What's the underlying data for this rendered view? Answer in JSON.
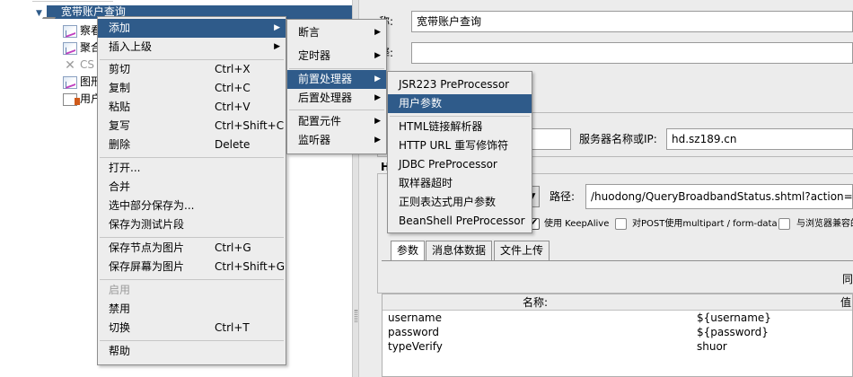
{
  "tree": {
    "items": [
      {
        "label": "宽带账户查询",
        "selected": true
      },
      {
        "label": "察看"
      },
      {
        "label": "聚合"
      },
      {
        "label": "CS"
      },
      {
        "label": "图形"
      },
      {
        "label": "用户"
      }
    ]
  },
  "context_menu": {
    "items": [
      {
        "label": "添加",
        "submenu": true,
        "highlighted": true
      },
      {
        "label": "插入上级",
        "submenu": true
      },
      {
        "label": "剪切",
        "shortcut": "Ctrl+X"
      },
      {
        "label": "复制",
        "shortcut": "Ctrl+C"
      },
      {
        "label": "粘贴",
        "shortcut": "Ctrl+V"
      },
      {
        "label": "复写",
        "shortcut": "Ctrl+Shift+C"
      },
      {
        "label": "删除",
        "shortcut": "Delete"
      },
      {
        "label": "打开..."
      },
      {
        "label": "合并"
      },
      {
        "label": "选中部分保存为..."
      },
      {
        "label": "保存为测试片段"
      },
      {
        "label": "保存节点为图片",
        "shortcut": "Ctrl+G"
      },
      {
        "label": "保存屏幕为图片",
        "shortcut": "Ctrl+Shift+G"
      },
      {
        "label": "启用",
        "disabled": true
      },
      {
        "label": "禁用"
      },
      {
        "label": "切换",
        "shortcut": "Ctrl+T"
      },
      {
        "label": "帮助"
      }
    ]
  },
  "add_submenu": {
    "items": [
      {
        "label": "断言"
      },
      {
        "label": "定时器"
      },
      {
        "label": "前置处理器",
        "highlighted": true
      },
      {
        "label": "后置处理器"
      },
      {
        "label": "配置元件"
      },
      {
        "label": "监听器"
      }
    ]
  },
  "preprocessor_submenu": {
    "items": [
      {
        "label": "JSR223 PreProcessor"
      },
      {
        "label": "用户参数",
        "highlighted": true
      },
      {
        "label": "HTML链接解析器"
      },
      {
        "label": "HTTP URL 重写修饰符"
      },
      {
        "label": "JDBC PreProcessor"
      },
      {
        "label": "取样器超时"
      },
      {
        "label": "正则表达式用户参数"
      },
      {
        "label": "BeanShell PreProcessor"
      }
    ]
  },
  "sampler": {
    "name_label": "称:",
    "name_value": "宽带账户查询",
    "comment_label": "释:",
    "server_label": "服务器名称或IP:",
    "server_value": "hd.sz189.cn",
    "section_label": "H",
    "path_label": "路径:",
    "path_value": "/huodong/QueryBroadbandStatus.shtml?action=Quer",
    "keepalive_label": "使用 KeepAlive",
    "multipart_label": "对POST使用multipart / form-data",
    "browser_headers_label": "与浏览器兼容的头",
    "tabs": [
      "参数",
      "消息体数据",
      "文件上传"
    ],
    "send_with_label": "同",
    "table_headers": [
      "名称:",
      "值"
    ],
    "params": [
      {
        "name": "username",
        "value": "${username}"
      },
      {
        "name": "password",
        "value": "${password}"
      },
      {
        "name": "typeVerify",
        "value": "shuor"
      }
    ]
  },
  "colors": {
    "highlight": "#2f5b8a",
    "menu_bg": "#ededed"
  }
}
